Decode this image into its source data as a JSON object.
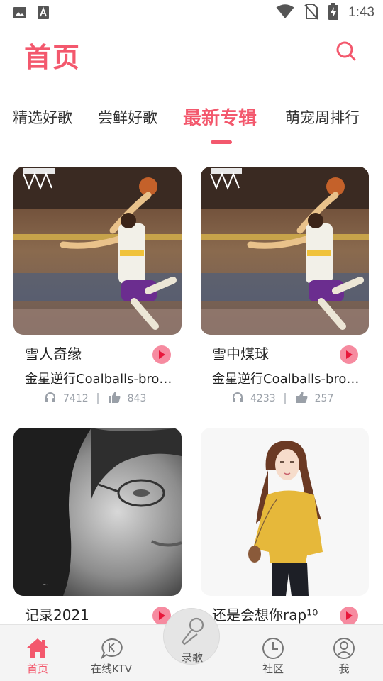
{
  "status_bar": {
    "time": "1:43",
    "left_icons": [
      "image-icon",
      "keyboard-a-icon"
    ],
    "right_icons": [
      "wifi-icon",
      "no-sim-icon",
      "battery-charging-icon"
    ]
  },
  "header": {
    "title": "首页",
    "search_icon": "search-icon"
  },
  "tabs": [
    {
      "label": "精选好歌",
      "active": false
    },
    {
      "label": "尝鲜好歌",
      "active": false
    },
    {
      "label": "最新专辑",
      "active": true
    },
    {
      "label": "萌宠周排行",
      "active": false
    }
  ],
  "cards": [
    {
      "title": "雪人奇缘",
      "artist": "金星逆行Coalballs-brothers",
      "listens": "7412",
      "likes": "843",
      "cover": "basketball-dunk-photo"
    },
    {
      "title": "雪中煤球",
      "artist": "金星逆行Coalballs-brothers",
      "listens": "4233",
      "likes": "257",
      "cover": "basketball-dunk-photo"
    },
    {
      "title": "记录2021",
      "cover": "woman-glasses-bw-photo"
    },
    {
      "title": "还是会想你rap¹⁰",
      "cover": "girl-yellow-sweater-illustration"
    }
  ],
  "bottom_nav": [
    {
      "label": "首页",
      "icon": "home-icon",
      "active": true
    },
    {
      "label": "在线KTV",
      "icon": "ktv-bubble-icon",
      "active": false
    },
    {
      "label": "录歌",
      "icon": "microphone-icon",
      "active": false
    },
    {
      "label": "社区",
      "icon": "clock-icon",
      "active": false
    },
    {
      "label": "我",
      "icon": "user-icon",
      "active": false
    }
  ],
  "colors": {
    "accent": "#f3586d",
    "play_button": "#f68ba0",
    "stats_text": "#9aa0a8",
    "nav_background": "#f4f4f4"
  }
}
